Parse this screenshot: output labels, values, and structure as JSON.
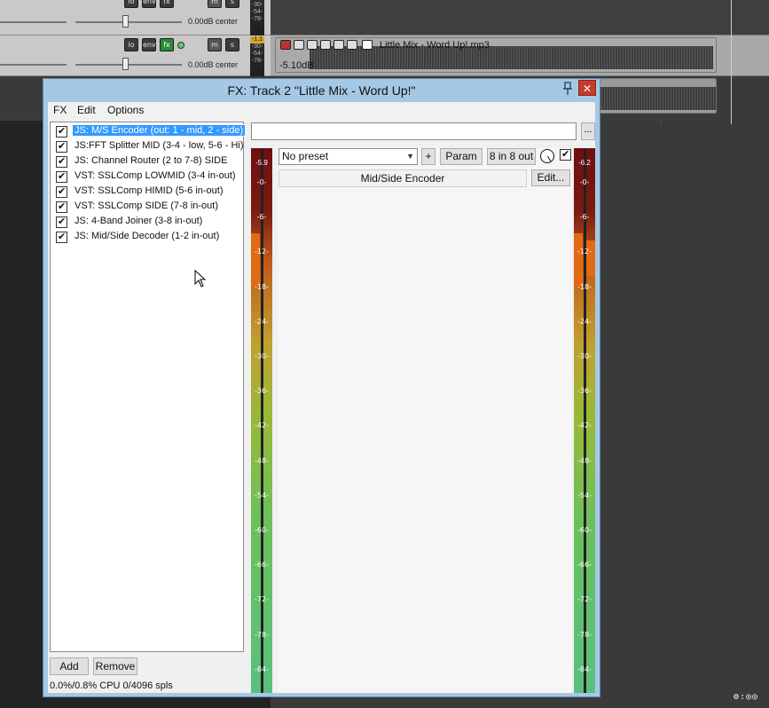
{
  "tracks": [
    {
      "readout": "0.00dB center",
      "io_label": "io",
      "env_label": "env",
      "fx_label": "fx",
      "mute_label": "m",
      "solo_label": "s",
      "meter_labels": [
        "-30-",
        "-54-",
        "-78-"
      ]
    },
    {
      "readout": "0.00dB center",
      "io_label": "io",
      "env_label": "env",
      "fx_label": "fx",
      "mute_label": "m",
      "solo_label": "s",
      "meter_labels": [
        "-1.1",
        "-30-",
        "-54-",
        "-78-"
      ]
    }
  ],
  "media_item": {
    "title": "Little Mix - Word Up!.mp3",
    "volume": "-5.10dB"
  },
  "corner_control": "⚙:◎◎",
  "window": {
    "title": "FX: Track 2 \"Little Mix - Word Up!\"",
    "pin_icon": "pin-icon",
    "close_glyph": "✕",
    "menu": [
      "FX",
      "Edit",
      "Options"
    ]
  },
  "fx_chain": [
    {
      "label": "JS: M/S Encoder (out: 1 - mid, 2 - side)",
      "selected": true
    },
    {
      "label": "JS:FFT Splitter MID (3-4 - low, 5-6 - Hi)",
      "selected": false
    },
    {
      "label": "JS: Channel Router (2 to 7-8) SIDE",
      "selected": false
    },
    {
      "label": "VST: SSLComp LOWMID (3-4 in-out)",
      "selected": false
    },
    {
      "label": "VST: SSLComp HIMID (5-6 in-out)",
      "selected": false
    },
    {
      "label": "VST: SSLComp SIDE (7-8 in-out)",
      "selected": false
    },
    {
      "label": "JS: 4-Band Joiner (3-8 in-out)",
      "selected": false
    },
    {
      "label": "JS: Mid/Side Decoder (1-2 in-out)",
      "selected": false
    }
  ],
  "buttons": {
    "add": "Add",
    "remove": "Remove",
    "dots": "...",
    "plus": "+",
    "param": "Param",
    "io": "8 in 8 out",
    "edit": "Edit..."
  },
  "cpu_status": "0.0%/0.8% CPU 0/4096 spls",
  "preset": {
    "value": "No preset"
  },
  "plugin_name": "Mid/Side Encoder",
  "meters": {
    "input_peak": "-5.9",
    "output_peak": "-6.2",
    "scale": [
      "-0-",
      "-6-",
      "-12-",
      "-18-",
      "-24-",
      "-30-",
      "-36-",
      "-42-",
      "-48-",
      "-54-",
      "-60-",
      "-66-",
      "-72-",
      "-78-",
      "-84-"
    ]
  },
  "colors": {
    "titlebar": "#a5c8e6",
    "selection": "#3399ff",
    "close": "#c73b2b",
    "fx_enabled": "#2c8a3a"
  }
}
